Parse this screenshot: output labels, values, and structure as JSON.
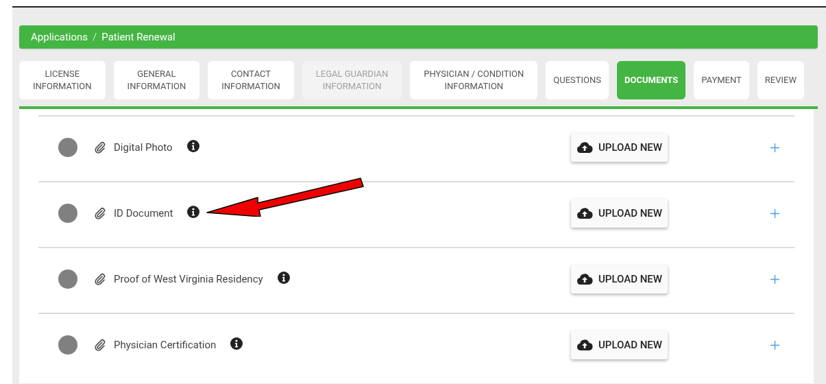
{
  "breadcrumb": {
    "items": [
      "Applications",
      "Patient Renewal"
    ],
    "separator": "/"
  },
  "tabs": [
    {
      "lines": [
        "LICENSE",
        "INFORMATION"
      ],
      "selected": false,
      "disabled": false
    },
    {
      "lines": [
        "GENERAL",
        "INFORMATION"
      ],
      "selected": false,
      "disabled": false
    },
    {
      "lines": [
        "CONTACT",
        "INFORMATION"
      ],
      "selected": false,
      "disabled": false
    },
    {
      "lines": [
        "LEGAL GUARDIAN",
        "INFORMATION"
      ],
      "selected": false,
      "disabled": true
    },
    {
      "lines": [
        "PHYSICIAN / CONDITION",
        "INFORMATION"
      ],
      "selected": false,
      "disabled": false
    },
    {
      "lines": [
        "QUESTIONS"
      ],
      "selected": false,
      "disabled": false
    },
    {
      "lines": [
        "DOCUMENTS"
      ],
      "selected": true,
      "disabled": false
    },
    {
      "lines": [
        "PAYMENT"
      ],
      "selected": false,
      "disabled": false
    },
    {
      "lines": [
        "REVIEW"
      ],
      "selected": false,
      "disabled": false
    }
  ],
  "documents": [
    {
      "name": "Digital Photo",
      "button": "UPLOAD NEW"
    },
    {
      "name": "ID Document",
      "button": "UPLOAD NEW"
    },
    {
      "name": "Proof of West Virginia Residency",
      "button": "UPLOAD NEW"
    },
    {
      "name": "Physician Certification",
      "button": "UPLOAD NEW"
    }
  ]
}
